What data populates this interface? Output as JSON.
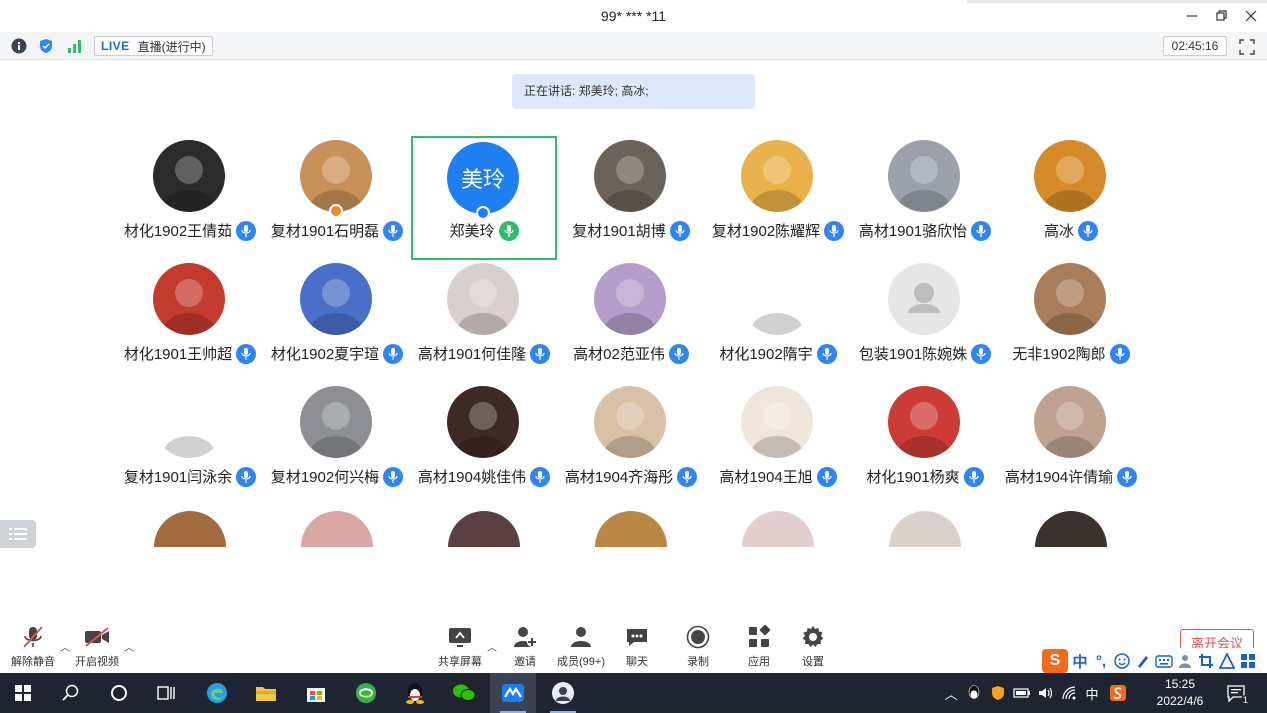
{
  "window": {
    "title": "99* *** *11"
  },
  "infobar": {
    "live_tag": "LIVE",
    "live_status": "直播(进行中)",
    "timer": "02:45:16"
  },
  "speaking": {
    "text": "正在讲话: 郑美玲; 高冰;"
  },
  "participants": [
    {
      "name": "材化1902王倩茹",
      "bg": "#2b2b2b"
    },
    {
      "name": "复材1901石明磊",
      "bg": "#c9915a",
      "host_badge": true
    },
    {
      "name": "郑美玲",
      "avatar_text": "美玲",
      "bg": "#1f7ff0",
      "active": true,
      "me_badge": true
    },
    {
      "name": "复材1901胡博",
      "bg": "#6b6258"
    },
    {
      "name": "复材1902陈耀辉",
      "bg": "#e9b24a"
    },
    {
      "name": "高材1901骆欣怡",
      "bg": "#9aa1ac"
    },
    {
      "name": "高冰",
      "bg": "#d68a2a"
    },
    {
      "name": "材化1901王帅超",
      "bg": "#c33a2f"
    },
    {
      "name": "材化1902夏宇瑄",
      "bg": "#4a6fc9"
    },
    {
      "name": "高材1901何佳隆",
      "bg": "#d9cfcd"
    },
    {
      "name": "高材02范亚伟",
      "bg": "#b59ec9"
    },
    {
      "name": "材化1902隋宇",
      "bg": "#ffffff"
    },
    {
      "name": "包装1901陈婉姝",
      "bg": "#e6e6e6",
      "placeholder": true
    },
    {
      "name": "无非1902陶郎",
      "bg": "#a97d5a"
    },
    {
      "name": "复材1901闫泳余",
      "bg": "#ffffff"
    },
    {
      "name": "复材1902何兴梅",
      "bg": "#8d8f94"
    },
    {
      "name": "高材1904姚佳伟",
      "bg": "#3d2a22"
    },
    {
      "name": "高材1904齐海彤",
      "bg": "#d8c1a6"
    },
    {
      "name": "高材1904王旭",
      "bg": "#f0e7da"
    },
    {
      "name": "材化1901杨爽",
      "bg": "#cc3b35"
    },
    {
      "name": "高材1904许倩瑜",
      "bg": "#bfa292"
    }
  ],
  "partial_row": [
    {
      "bg": "#a16b3d"
    },
    {
      "bg": "#d9a7a4"
    },
    {
      "bg": "#5a4040"
    },
    {
      "bg": "#b98744"
    },
    {
      "bg": "#e4cfcf"
    },
    {
      "bg": "#d9d2cb"
    },
    {
      "bg": "#3a332c"
    }
  ],
  "toolbar": {
    "unmute": "解除静音",
    "start_video": "开启视频",
    "share_screen": "共享屏幕",
    "invite": "邀请",
    "members": "成员(99+)",
    "chat": "聊天",
    "record": "录制",
    "apps": "应用",
    "settings": "设置",
    "leave": "离开会议"
  },
  "ime": {
    "logo": "S",
    "lang": "中",
    "punct": "°,"
  },
  "taskbar": {
    "time": "15:25",
    "date": "2022/4/6",
    "tray_lang": "中",
    "notification_count": "1"
  },
  "colors": {
    "accent_blue": "#2e86f5",
    "active_border": "#2fbd6b",
    "leave_red": "#e0524d",
    "taskbar": "#1f2530"
  }
}
